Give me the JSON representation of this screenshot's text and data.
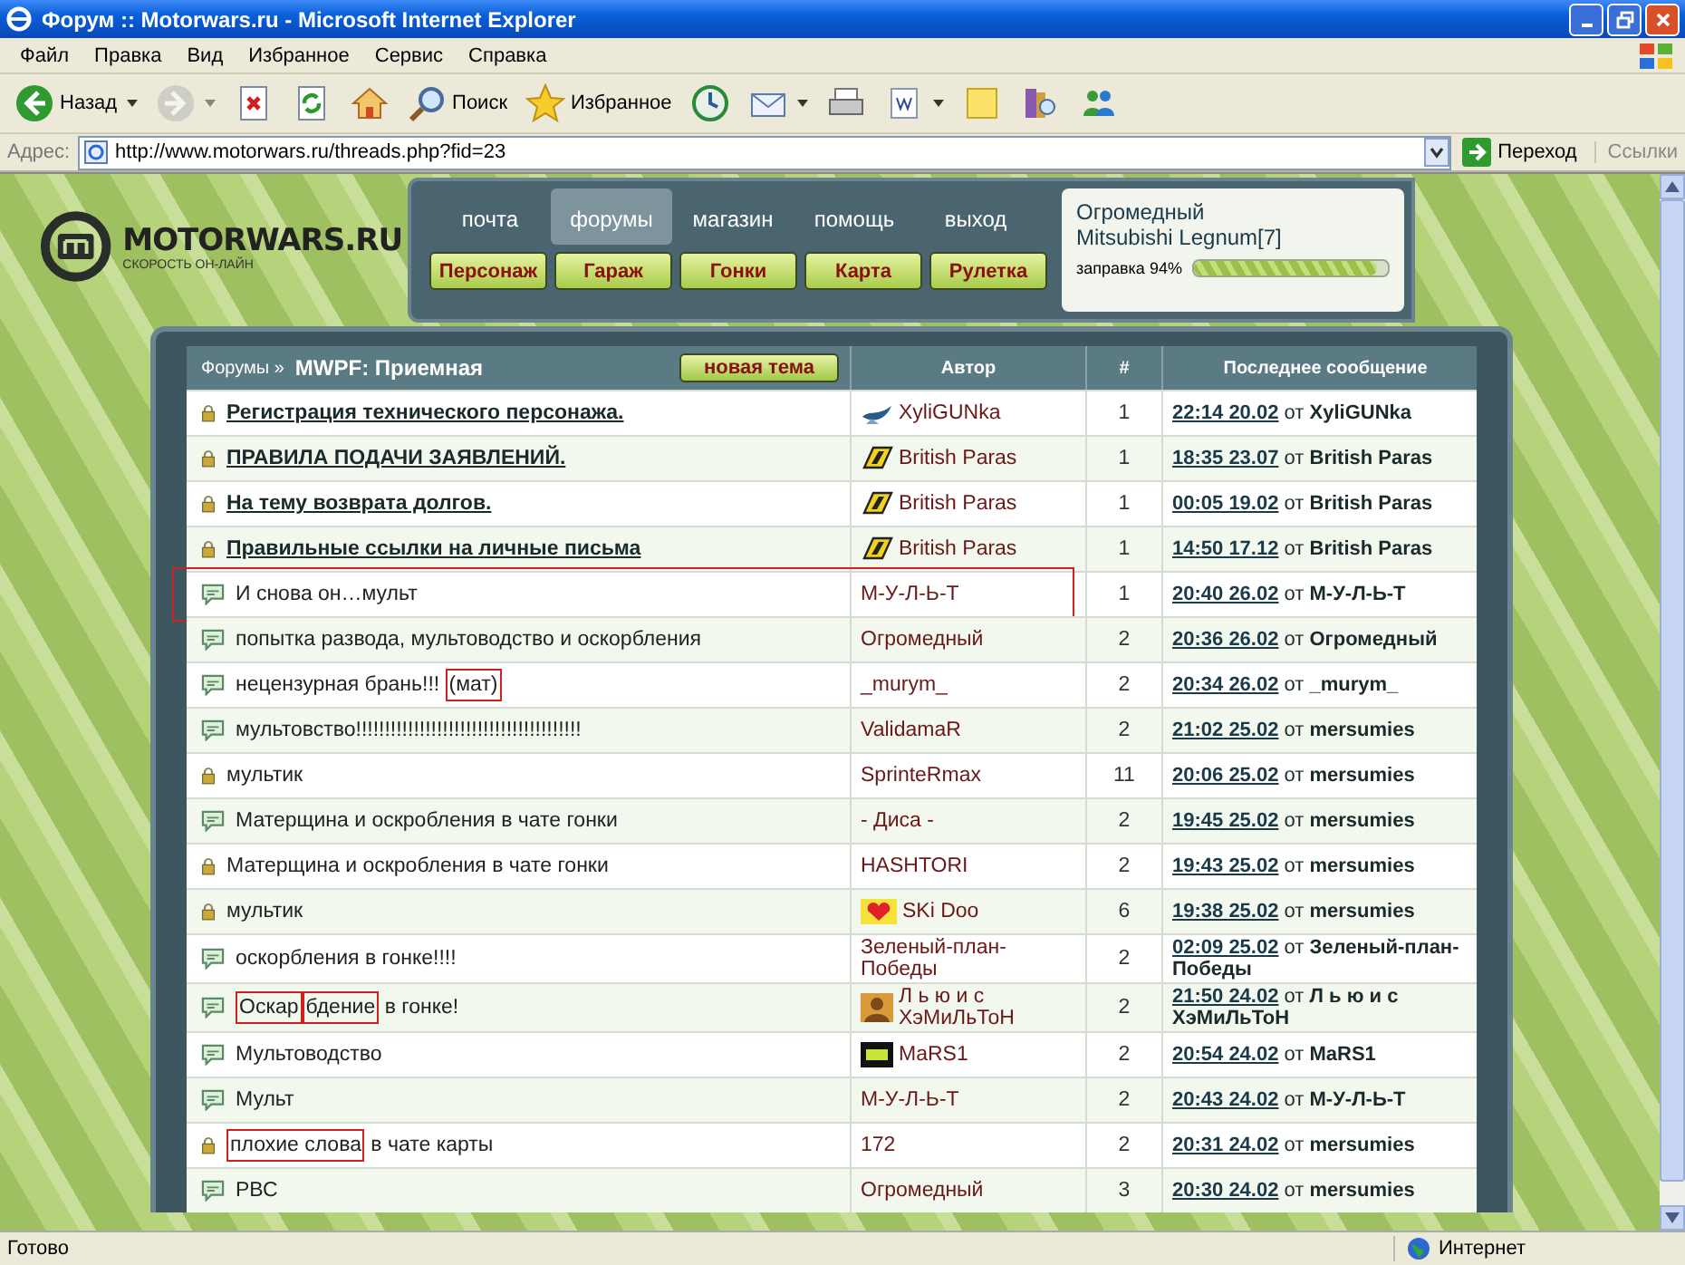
{
  "window": {
    "title": "Форум :: Motorwars.ru - Microsoft Internet Explorer"
  },
  "menu": [
    "Файл",
    "Правка",
    "Вид",
    "Избранное",
    "Сервис",
    "Справка"
  ],
  "toolbar": [
    {
      "kind": "back",
      "label": "Назад",
      "dropdown": true,
      "disabled": false
    },
    {
      "kind": "forward",
      "dropdown": true,
      "disabled": true
    },
    {
      "kind": "stop",
      "dropdown": false,
      "disabled": false
    },
    {
      "kind": "refresh",
      "dropdown": false,
      "disabled": false
    },
    {
      "kind": "home",
      "dropdown": false,
      "disabled": false
    },
    {
      "kind": "search",
      "label": "Поиск",
      "dropdown": false,
      "disabled": false
    },
    {
      "kind": "favorites",
      "label": "Избранное",
      "dropdown": false,
      "disabled": false
    },
    {
      "kind": "history",
      "dropdown": false,
      "disabled": false
    },
    {
      "kind": "mail",
      "dropdown": true,
      "disabled": false
    },
    {
      "kind": "print",
      "dropdown": false,
      "disabled": false
    },
    {
      "kind": "edit",
      "dropdown": true,
      "disabled": false
    },
    {
      "kind": "notes",
      "dropdown": false,
      "disabled": false
    },
    {
      "kind": "research",
      "dropdown": false,
      "disabled": false
    },
    {
      "kind": "messenger",
      "dropdown": false,
      "disabled": false
    }
  ],
  "address": {
    "label": "Адрес:",
    "url": "http://www.motorwars.ru/threads.php?fid=23",
    "go": "Переход",
    "links": "Ссылки"
  },
  "site": {
    "logo": "MOTORWARS.RU",
    "tagline": "СКОРОСТЬ ОН-ЛАЙН",
    "nav": [
      {
        "label": "почта",
        "selected": false
      },
      {
        "label": "форумы",
        "selected": true
      },
      {
        "label": "магазин",
        "selected": false
      },
      {
        "label": "помощь",
        "selected": false
      },
      {
        "label": "выход",
        "selected": false
      }
    ],
    "actions": [
      "Персонаж",
      "Гараж",
      "Гонки",
      "Карта",
      "Рулетка"
    ],
    "user": {
      "name": "Огромедный",
      "car": "Mitsubishi Legnum[7]",
      "fuel_label": "заправка 94%",
      "level": 0.94
    }
  },
  "forum": {
    "breadcrumb": "Форумы »",
    "title": "MWPF: Приемная",
    "new_topic": "новая тема",
    "columns": [
      "Автор",
      "#",
      "Последнее сообщение"
    ],
    "rows": [
      {
        "kind": "locked",
        "sticky": true,
        "marked": false,
        "topic": [
          {
            "text": "Регистрация технического персонажа.",
            "boxed": false
          }
        ],
        "avatar": {
          "kind": "bird"
        },
        "author": "XyliGUNka",
        "replies": "1",
        "time": "22:14 20.02",
        "by": "от",
        "last_author": "XyliGUNka"
      },
      {
        "kind": "locked",
        "sticky": true,
        "marked": false,
        "topic": [
          {
            "text": "ПРАВИЛА ПОДАЧИ ЗАЯВЛЕНИЙ.",
            "boxed": false
          }
        ],
        "avatar": {
          "kind": "emblem"
        },
        "author": "British Paras",
        "replies": "1",
        "time": "18:35 23.07",
        "by": "от",
        "last_author": "British Paras"
      },
      {
        "kind": "locked",
        "sticky": true,
        "marked": false,
        "topic": [
          {
            "text": "На тему возврата долгов.",
            "boxed": false
          }
        ],
        "avatar": {
          "kind": "emblem"
        },
        "author": "British Paras",
        "replies": "1",
        "time": "00:05 19.02",
        "by": "от",
        "last_author": "British Paras"
      },
      {
        "kind": "locked",
        "sticky": true,
        "marked": false,
        "topic": [
          {
            "text": "Правильные ссылки на личные письма",
            "boxed": false
          }
        ],
        "avatar": {
          "kind": "emblem"
        },
        "author": "British Paras",
        "replies": "1",
        "time": "14:50 17.12",
        "by": "от",
        "last_author": "British Paras"
      },
      {
        "kind": "open",
        "sticky": false,
        "marked": true,
        "topic": [
          {
            "text": "И снова он…мульт",
            "boxed": false
          }
        ],
        "author": "М-У-Л-Ь-Т",
        "replies": "1",
        "time": "20:40 26.02",
        "by": "от",
        "last_author": "М-У-Л-Ь-Т"
      },
      {
        "kind": "open",
        "sticky": false,
        "marked": false,
        "topic": [
          {
            "text": "попытка развода, мультоводство и оскорбления",
            "boxed": false
          }
        ],
        "author": "Огромедный",
        "replies": "2",
        "time": "20:36 26.02",
        "by": "от",
        "last_author": "Огромедный"
      },
      {
        "kind": "open",
        "sticky": false,
        "marked": false,
        "topic": [
          {
            "text": "нецензурная брань!!! ",
            "boxed": false
          },
          {
            "text": "(мат)",
            "boxed": true
          }
        ],
        "author": "_murym_",
        "replies": "2",
        "time": "20:34 26.02",
        "by": "от",
        "last_author": "_murym_"
      },
      {
        "kind": "open",
        "sticky": false,
        "marked": false,
        "topic": [
          {
            "text": "мультовство!!!!!!!!!!!!!!!!!!!!!!!!!!!!!!!!!!!!!!!",
            "boxed": false
          }
        ],
        "author": "ValidamaR",
        "replies": "2",
        "time": "21:02 25.02",
        "by": "от",
        "last_author": "mersumies"
      },
      {
        "kind": "locked",
        "sticky": false,
        "marked": false,
        "topic": [
          {
            "text": "мультик",
            "boxed": false
          }
        ],
        "author": "SprinteRmax",
        "replies": "11",
        "time": "20:06 25.02",
        "by": "от",
        "last_author": "mersumies"
      },
      {
        "kind": "open",
        "sticky": false,
        "marked": false,
        "topic": [
          {
            "text": "Матерщина и оскробления в чате гонки",
            "boxed": false
          }
        ],
        "author": "- Диса -",
        "replies": "2",
        "time": "19:45 25.02",
        "by": "от",
        "last_author": "mersumies"
      },
      {
        "kind": "locked",
        "sticky": false,
        "marked": false,
        "topic": [
          {
            "text": "Матерщина и оскробления в чате гонки",
            "boxed": false
          }
        ],
        "author": "HASHTORI",
        "replies": "2",
        "time": "19:43 25.02",
        "by": "от",
        "last_author": "mersumies"
      },
      {
        "kind": "locked",
        "sticky": false,
        "marked": false,
        "topic": [
          {
            "text": "мультик",
            "boxed": false
          }
        ],
        "avatar": {
          "kind": "heart"
        },
        "author": "SKi Doo",
        "replies": "6",
        "time": "19:38 25.02",
        "by": "от",
        "last_author": "mersumies"
      },
      {
        "kind": "open",
        "sticky": false,
        "marked": false,
        "topic": [
          {
            "text": "оскорбления в гонке!!!!",
            "boxed": false
          }
        ],
        "author": "Зеленый-план-Победы",
        "replies": "2",
        "time": "02:09 25.02",
        "by": "от",
        "last_author": "Зеленый-план-Победы"
      },
      {
        "kind": "open",
        "sticky": false,
        "marked": false,
        "topic": [
          {
            "text": "Оскар",
            "boxed": true
          },
          {
            "text": "бдение",
            "boxed": true
          },
          {
            "text": " в гонке!",
            "boxed": false
          }
        ],
        "avatar": {
          "kind": "person"
        },
        "author": "Л ь ю и с ХэМиЛьТоН",
        "replies": "2",
        "time": "21:50 24.02",
        "by": "от",
        "last_author": "Л ь ю и с ХэМиЛьТоН"
      },
      {
        "kind": "open",
        "sticky": false,
        "marked": false,
        "topic": [
          {
            "text": "Мультоводство",
            "boxed": false
          }
        ],
        "avatar": {
          "kind": "badge"
        },
        "author": "MaRS1",
        "replies": "2",
        "time": "20:54 24.02",
        "by": "от",
        "last_author": "MaRS1"
      },
      {
        "kind": "open",
        "sticky": false,
        "marked": false,
        "topic": [
          {
            "text": "Мульт",
            "boxed": false
          }
        ],
        "author": "М-У-Л-Ь-Т",
        "replies": "2",
        "time": "20:43 24.02",
        "by": "от",
        "last_author": "М-У-Л-Ь-Т"
      },
      {
        "kind": "locked",
        "sticky": false,
        "marked": false,
        "topic": [
          {
            "text": "плохие слова",
            "boxed": true
          },
          {
            "text": " в чате карты",
            "boxed": false
          }
        ],
        "author": "172",
        "replies": "2",
        "time": "20:31 24.02",
        "by": "от",
        "last_author": "mersumies"
      },
      {
        "kind": "open",
        "sticky": false,
        "marked": false,
        "topic": [
          {
            "text": "РВС",
            "boxed": false
          }
        ],
        "author": "Огромедный",
        "replies": "3",
        "time": "20:30 24.02",
        "by": "от",
        "last_author": "mersumies"
      }
    ]
  },
  "status_bar": {
    "text": "Готово",
    "zone": "Интернет"
  }
}
